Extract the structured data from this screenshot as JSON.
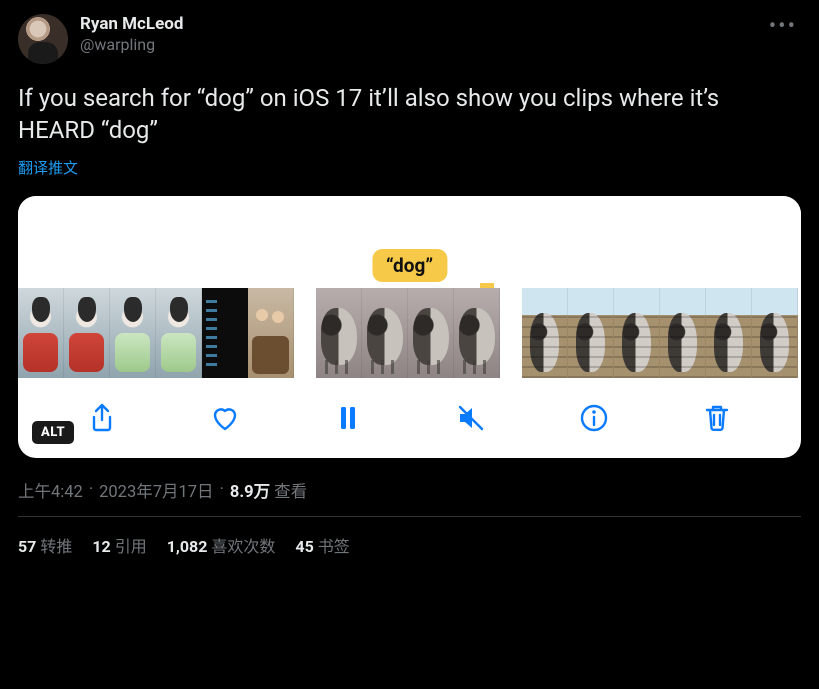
{
  "author": {
    "display_name": "Ryan McLeod",
    "handle": "@warpling"
  },
  "tweet": {
    "text": "If you search for “dog” on iOS 17 it’ll also show you clips where it’s HEARD “dog”",
    "translate_label": "翻译推文"
  },
  "media": {
    "caption_tag": "“dog”",
    "alt_badge": "ALT",
    "toolbar_icons": {
      "share": "share-icon",
      "like": "heart-icon",
      "pause": "pause-icon",
      "mute": "mute-icon",
      "info": "info-icon",
      "delete": "trash-icon"
    }
  },
  "meta": {
    "time": "上午4:42",
    "date": "2023年7月17日",
    "views_count": "8.9万",
    "views_label": "查看"
  },
  "stats": {
    "retweets": {
      "count": "57",
      "label": "转推"
    },
    "quotes": {
      "count": "12",
      "label": "引用"
    },
    "likes": {
      "count": "1,082",
      "label": "喜欢次数"
    },
    "bookmarks": {
      "count": "45",
      "label": "书签"
    }
  }
}
